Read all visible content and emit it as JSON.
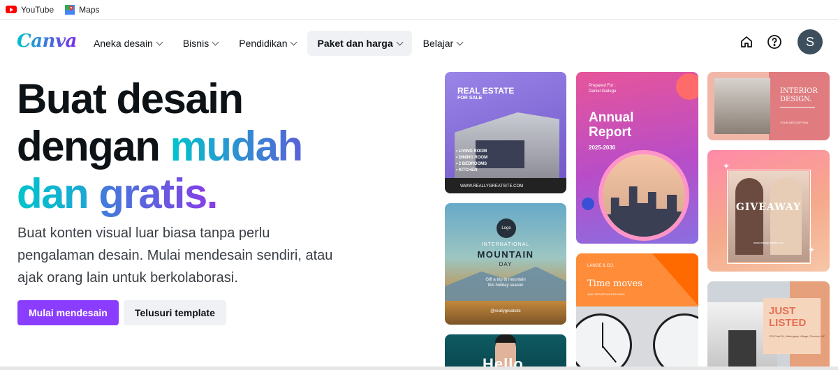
{
  "bookmarks": [
    {
      "label": "YouTube",
      "icon": "youtube-icon"
    },
    {
      "label": "Maps",
      "icon": "maps-icon"
    }
  ],
  "nav": {
    "logo": "Canva",
    "menu": [
      {
        "label": "Aneka desain"
      },
      {
        "label": "Bisnis"
      },
      {
        "label": "Pendidikan"
      },
      {
        "label": "Paket dan harga",
        "active": true
      },
      {
        "label": "Belajar"
      }
    ],
    "icons": [
      "home-icon",
      "help-icon"
    ],
    "avatar_initial": "S"
  },
  "hero": {
    "title_line1": "Buat desain",
    "title_line2_a": "dengan ",
    "title_line2_b": "mudah",
    "title_line3_a": "dan ",
    "title_line3_b": "gratis.",
    "subtitle": "Buat konten visual luar biasa tanpa perlu pengalaman desain. Mulai mendesain sendiri, atau ajak orang lain untuk berkolaborasi.",
    "primary_button": "Mulai mendesain",
    "secondary_button": "Telusuri template"
  },
  "templates": {
    "real_estate": {
      "title": "REAL ESTATE",
      "subtitle": "FOR SALE",
      "features": [
        "• LIVING ROOM",
        "• DINING ROOM",
        "• 2 BEDROOMS",
        "• KITCHEN"
      ],
      "url": "WWW.REALLYGREATSITE.COM"
    },
    "annual_report": {
      "prepared": "Prepared For :",
      "name": "Daniel Gallego",
      "title_line1": "Annual",
      "title_line2": "Report",
      "years": "2025-2030"
    },
    "interior": {
      "title_line1": "INTERIOR",
      "title_line2": "DESIGN.",
      "small": "YOUR DESCRIPTION"
    },
    "giveaway": {
      "title": "GIVEAWAY",
      "fine": "www.reallygreatsite.com"
    },
    "mountain": {
      "logo": "Logo",
      "line1": "INTERNATIONAL",
      "line2": "MOUNTAIN",
      "line3": "DAY",
      "tagline_1": "Gift a trip to mountain",
      "tagline_2": "this holiday season",
      "handle": "@reallygreatsite"
    },
    "time_moves": {
      "brand": "LANGE & CO.",
      "title": "Time moves",
      "sub": "AND OPPORTUNITIES PASS"
    },
    "just_listed": {
      "title_line1": "JUST",
      "title_line2": "LISTED",
      "address": "123 Chat St., Mahogany Village, Phoenix, AZ"
    },
    "hello": {
      "title": "Hello"
    }
  }
}
